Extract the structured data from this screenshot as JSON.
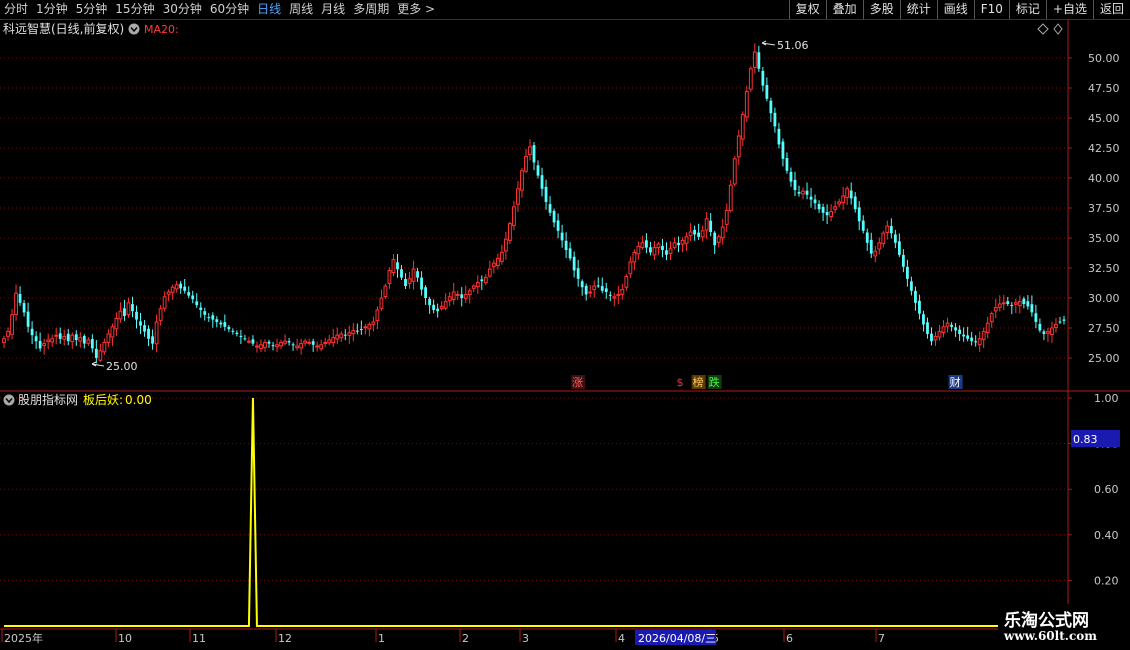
{
  "toolbar": {
    "periods": [
      "分时",
      "1分钟",
      "5分钟",
      "15分钟",
      "30分钟",
      "60分钟",
      "日线",
      "周线",
      "月线",
      "多周期",
      "更多"
    ],
    "active_period": "日线",
    "more_arrow": ">",
    "buttons": [
      "复权",
      "叠加",
      "多股",
      "统计",
      "画线",
      "F10",
      "标记",
      "+自选",
      "返回"
    ]
  },
  "main_panel": {
    "title": "科远智慧(日线,前复权)",
    "indicator": "MA20:",
    "high_label": "51.06",
    "low_label": "25.00",
    "markers": [
      {
        "text": "涨",
        "color": "#ff6060",
        "bg": "#3a1010",
        "index": 143
      },
      {
        "text": "$",
        "color": "#ff3030",
        "bg": "#000000",
        "index": 169
      },
      {
        "text": "榜",
        "color": "#ffcc66",
        "bg": "#5a3a00",
        "index": 173
      },
      {
        "text": "跌",
        "color": "#40ff40",
        "bg": "#103a10",
        "index": 177
      },
      {
        "text": "财",
        "color": "#ffffff",
        "bg": "#1a3a8a",
        "index": 237
      }
    ]
  },
  "sub_panel": {
    "title": "股朋指标网",
    "indicator_name": "板后妖:",
    "indicator_value": "0.00",
    "current_value": "0.83"
  },
  "axis": {
    "price_ticks": [
      "50.00",
      "47.50",
      "45.00",
      "42.50",
      "40.00",
      "37.50",
      "35.00",
      "32.50",
      "30.00",
      "27.50",
      "25.00"
    ],
    "sub_ticks": [
      "1.00",
      "0.80",
      "0.60",
      "0.40",
      "0.20"
    ],
    "date_labels": [
      "2025年",
      "10",
      "11",
      "12",
      "1",
      "2",
      "3",
      "4",
      "5",
      "6",
      "7"
    ],
    "cursor_date": "2026/04/08/三"
  },
  "watermark": {
    "line1": "乐淘公式网",
    "line2": "www.60lt.com"
  },
  "colors": {
    "up": "#ff3232",
    "down": "#54ffff",
    "grid": "#7a1010",
    "axis_text": "#c8c8c8",
    "indicator_line": "#ffff00",
    "active": "#4ea6ff"
  },
  "chart_data": {
    "type": "candlestick",
    "y_range": [
      24.0,
      51.5
    ],
    "sub_y_range": [
      0,
      1
    ],
    "peak": 51.06,
    "trough": 25.0,
    "closes": [
      26.6,
      27.2,
      28.6,
      30.4,
      29.6,
      28.8,
      27.6,
      26.9,
      26.4,
      25.8,
      26.2,
      26.5,
      26.6,
      26.9,
      26.6,
      26.8,
      26.4,
      26.9,
      26.5,
      26.7,
      26.2,
      26.5,
      25.8,
      25.0,
      25.6,
      26.3,
      27.0,
      27.6,
      28.3,
      28.9,
      28.5,
      29.6,
      28.9,
      28.2,
      27.7,
      27.2,
      26.6,
      26.2,
      28.0,
      29.1,
      30.1,
      30.5,
      30.9,
      31.1,
      30.8,
      30.6,
      30.2,
      29.9,
      29.4,
      29.0,
      28.6,
      28.4,
      28.2,
      28.0,
      27.8,
      27.6,
      27.4,
      27.2,
      27.0,
      26.8,
      26.6,
      26.4,
      26.2,
      26.0,
      26.1,
      26.3,
      26.2,
      26.0,
      26.1,
      26.3,
      26.4,
      26.3,
      26.1,
      26.0,
      26.2,
      26.4,
      26.3,
      26.1,
      26.0,
      26.1,
      26.3,
      26.5,
      26.7,
      26.9,
      27.0,
      26.9,
      27.1,
      27.3,
      27.2,
      27.4,
      27.6,
      27.8,
      28.0,
      29.0,
      30.0,
      31.0,
      32.3,
      33.2,
      32.4,
      31.7,
      31.0,
      31.6,
      32.4,
      31.7,
      30.7,
      30.0,
      29.4,
      29.0,
      28.9,
      29.3,
      29.7,
      30.1,
      30.5,
      30.3,
      30.0,
      30.3,
      30.6,
      31.0,
      31.3,
      31.4,
      31.7,
      32.4,
      32.9,
      33.3,
      33.8,
      34.9,
      36.2,
      37.6,
      39.1,
      40.6,
      41.8,
      42.6,
      41.3,
      40.2,
      39.1,
      38.0,
      37.1,
      36.3,
      35.6,
      34.8,
      34.0,
      33.3,
      32.3,
      31.6,
      30.9,
      30.3,
      30.5,
      31.0,
      31.0,
      30.6,
      30.5,
      30.2,
      30.1,
      30.3,
      30.7,
      31.8,
      33.0,
      33.8,
      34.3,
      34.6,
      34.2,
      33.8,
      34.2,
      34.5,
      34.0,
      33.6,
      34.1,
      34.6,
      34.4,
      34.8,
      35.1,
      35.5,
      35.3,
      35.1,
      35.6,
      36.6,
      35.5,
      34.4,
      35.1,
      35.9,
      37.3,
      39.4,
      41.6,
      43.5,
      45.3,
      47.2,
      49.1,
      50.5,
      49.1,
      47.7,
      46.6,
      45.4,
      44.3,
      42.8,
      41.6,
      40.6,
      39.7,
      39.0,
      38.7,
      38.9,
      38.6,
      38.2,
      37.9,
      37.4,
      37.1,
      36.9,
      37.2,
      37.6,
      38.0,
      38.5,
      39.1,
      38.3,
      37.4,
      36.4,
      35.6,
      34.6,
      33.7,
      33.9,
      34.6,
      35.4,
      36.0,
      35.4,
      34.6,
      33.6,
      32.6,
      31.6,
      30.6,
      29.6,
      28.7,
      27.8,
      27.0,
      26.4,
      26.8,
      27.2,
      27.6,
      27.9,
      27.6,
      27.3,
      27.0,
      26.8,
      26.6,
      26.4,
      26.3,
      26.6,
      27.2,
      27.9,
      28.7,
      29.2,
      29.5,
      29.6,
      29.5,
      29.4,
      29.6,
      29.7,
      29.5,
      29.3,
      28.8,
      28.0,
      27.3,
      27.0,
      27.2,
      27.5,
      27.8,
      28.0,
      28.1
    ],
    "indicator": {
      "spike_index": 62,
      "spike_value": 1.0,
      "baseline": 0.0
    }
  }
}
